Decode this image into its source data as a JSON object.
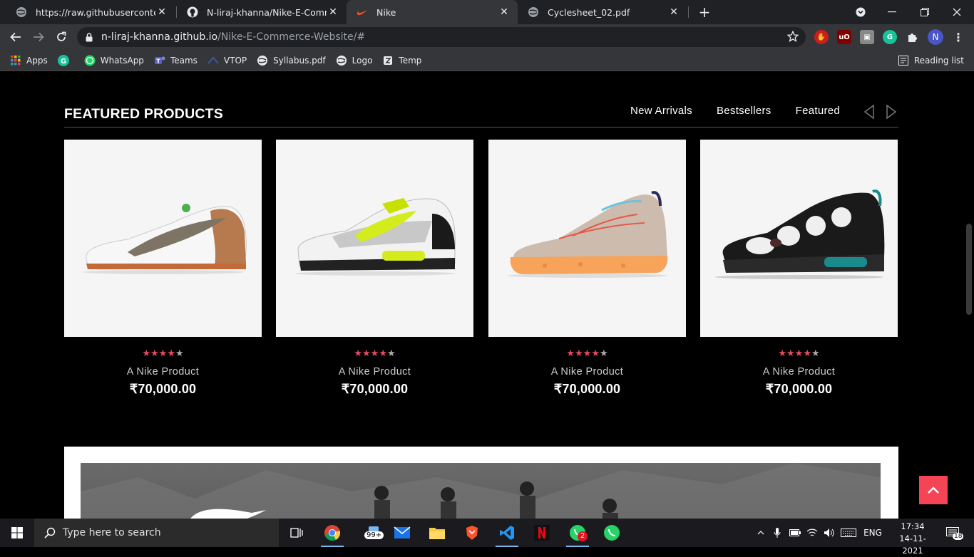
{
  "browser": {
    "tabs": [
      {
        "title": "https://raw.githubusercontent.co",
        "icon": "globe-icon"
      },
      {
        "title": "N-liraj-khanna/Nike-E-Commerce",
        "icon": "github-icon"
      },
      {
        "title": "Nike",
        "icon": "nike-swoosh-icon",
        "active": true
      },
      {
        "title": "Cyclesheet_02.pdf",
        "icon": "globe-icon"
      }
    ],
    "url_host": "n-liraj-khanna.github.io",
    "url_path": "/Nike-E-Commerce-Website/#",
    "profile_initial": "N",
    "bookmarks": [
      {
        "label": "Apps",
        "icon": "apps-grid-icon"
      },
      {
        "label": "",
        "icon": "grammarly-icon"
      },
      {
        "label": "WhatsApp",
        "icon": "whatsapp-icon"
      },
      {
        "label": "Teams",
        "icon": "teams-icon"
      },
      {
        "label": "VTOP",
        "icon": "vtop-icon"
      },
      {
        "label": "Syllabus.pdf",
        "icon": "globe-icon"
      },
      {
        "label": "Logo",
        "icon": "globe-icon"
      },
      {
        "label": "Temp",
        "icon": "temp-icon"
      }
    ],
    "reading_list": "Reading list"
  },
  "page": {
    "section_title": "FEATURED PRODUCTS",
    "filter_tabs": [
      "New Arrivals",
      "Bestsellers",
      "Featured"
    ],
    "accent_color": "#e84a5f",
    "products": [
      {
        "name": "A Nike Product",
        "price": "₹70,000.00",
        "rating": 4,
        "max_rating": 5,
        "image": "white-tan-sneaker"
      },
      {
        "name": "A Nike Product",
        "price": "₹70,000.00",
        "rating": 4,
        "max_rating": 5,
        "image": "white-volt-sneaker"
      },
      {
        "name": "A Nike Product",
        "price": "₹70,000.00",
        "rating": 4,
        "max_rating": 5,
        "image": "beige-orange-sneaker"
      },
      {
        "name": "A Nike Product",
        "price": "₹70,000.00",
        "rating": 4,
        "max_rating": 5,
        "image": "black-white-sneaker"
      }
    ]
  },
  "taskbar": {
    "search_placeholder": "Type here to search",
    "mail_badge": "99+",
    "whatsapp_badge": "2",
    "language": "ENG",
    "time": "17:34",
    "date": "14-11-2021",
    "notification_count": "18"
  }
}
